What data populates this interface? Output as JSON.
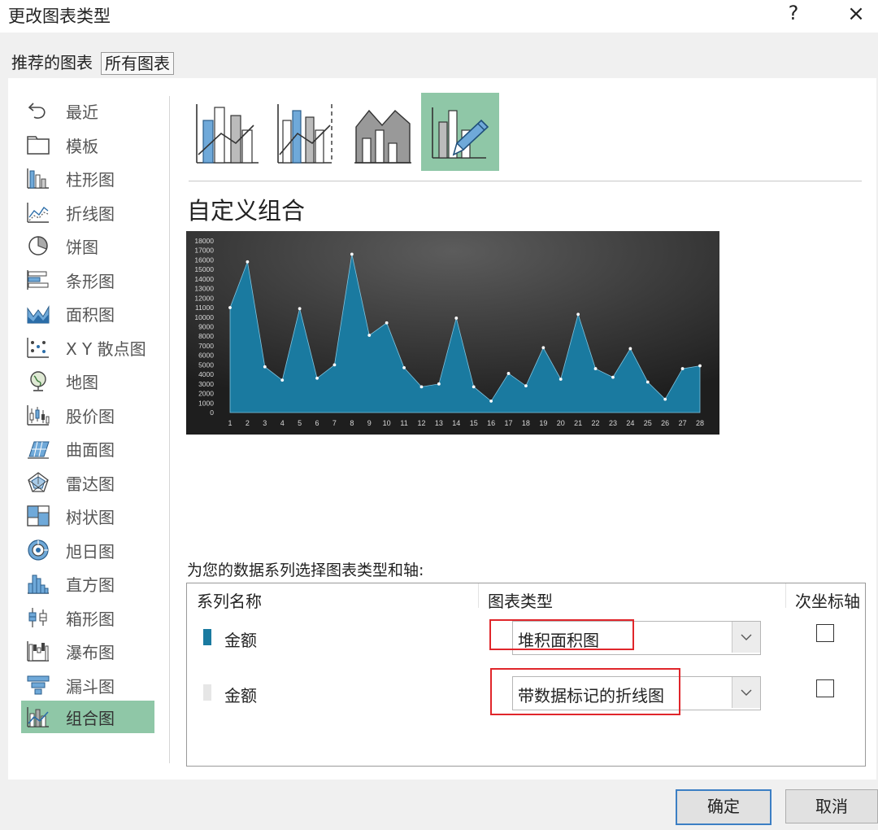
{
  "window": {
    "title": "更改图表类型",
    "help": "?",
    "close": "×"
  },
  "tabs": [
    {
      "label": "推荐的图表"
    },
    {
      "label": "所有图表"
    }
  ],
  "sidebar": {
    "items": [
      {
        "label": "最近",
        "icon": "undo-icon"
      },
      {
        "label": "模板",
        "icon": "folder-icon"
      },
      {
        "label": "柱形图",
        "icon": "column-chart-icon"
      },
      {
        "label": "折线图",
        "icon": "line-chart-icon"
      },
      {
        "label": "饼图",
        "icon": "pie-chart-icon"
      },
      {
        "label": "条形图",
        "icon": "bar-chart-icon"
      },
      {
        "label": "面积图",
        "icon": "area-chart-icon"
      },
      {
        "label": "X Y 散点图",
        "icon": "scatter-chart-icon"
      },
      {
        "label": "地图",
        "icon": "globe-icon"
      },
      {
        "label": "股价图",
        "icon": "stock-chart-icon"
      },
      {
        "label": "曲面图",
        "icon": "surface-chart-icon"
      },
      {
        "label": "雷达图",
        "icon": "radar-chart-icon"
      },
      {
        "label": "树状图",
        "icon": "treemap-chart-icon"
      },
      {
        "label": "旭日图",
        "icon": "sunburst-chart-icon"
      },
      {
        "label": "直方图",
        "icon": "histogram-icon"
      },
      {
        "label": "箱形图",
        "icon": "box-whisker-icon"
      },
      {
        "label": "瀑布图",
        "icon": "waterfall-chart-icon"
      },
      {
        "label": "漏斗图",
        "icon": "funnel-chart-icon"
      },
      {
        "label": "组合图",
        "icon": "combo-chart-icon",
        "selected": true
      }
    ]
  },
  "combo_types": {
    "selected_index": 3
  },
  "preview": {
    "title": "自定义组合"
  },
  "series_section": {
    "prompt": "为您的数据系列选择图表类型和轴:",
    "headers": {
      "name": "系列名称",
      "type": "图表类型",
      "secondary": "次坐标轴"
    },
    "rows": [
      {
        "name": "金额",
        "color": "#1a7aa0",
        "chart_type": "堆积面积图",
        "secondary_axis": false
      },
      {
        "name": "金额",
        "color": "#e6e6e6",
        "chart_type": "带数据标记的折线图",
        "secondary_axis": false
      }
    ]
  },
  "buttons": {
    "ok": "确定",
    "cancel": "取消"
  },
  "colors": {
    "accent_green": "#8fc7a7",
    "area_fill": "#1a7aa0",
    "highlight_red": "#e0262b"
  },
  "chart_data": {
    "type": "area",
    "x": [
      1,
      2,
      3,
      4,
      5,
      6,
      7,
      8,
      9,
      10,
      11,
      12,
      13,
      14,
      15,
      16,
      17,
      18,
      19,
      20,
      21,
      22,
      23,
      24,
      25,
      26,
      27,
      28
    ],
    "series": [
      {
        "values": [
          11000,
          15800,
          4800,
          3400,
          10900,
          3600,
          5000,
          16600,
          8100,
          9400,
          4700,
          2700,
          3000,
          9900,
          2700,
          1200,
          4100,
          2800,
          6800,
          3500,
          10300,
          4600,
          3700,
          6700,
          3200,
          1400,
          4600,
          4900
        ]
      }
    ],
    "y_ticks": [
      0,
      1000,
      2000,
      3000,
      4000,
      5000,
      6000,
      7000,
      8000,
      9000,
      10000,
      11000,
      12000,
      13000,
      14000,
      15000,
      16000,
      17000,
      18000
    ],
    "ylim": [
      0,
      18000
    ],
    "grid": false,
    "markers": true
  }
}
